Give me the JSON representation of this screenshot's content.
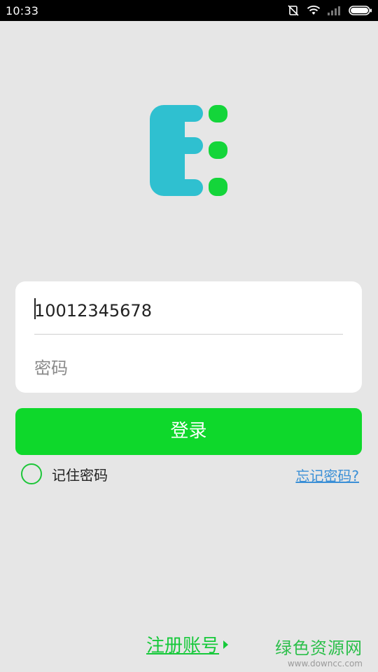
{
  "status_bar": {
    "time": "10:33",
    "icons": [
      "vibrate-off-icon",
      "wifi-icon",
      "signal-icon",
      "battery-icon"
    ]
  },
  "logo": {
    "name": "app-logo",
    "colors": {
      "letter": "#2fc0d0",
      "dots": "#14d53a"
    }
  },
  "login_form": {
    "phone": {
      "value": "10012345678",
      "placeholder": ""
    },
    "password": {
      "value": "",
      "placeholder": "密码"
    }
  },
  "login_button": {
    "label": "登录",
    "color": "#0ed82b"
  },
  "remember": {
    "label": "记住密码",
    "checked": false
  },
  "forgot_link": {
    "label": "忘记密码?"
  },
  "register_link": {
    "label": "注册账号",
    "icon": "arrow-right-icon"
  },
  "watermark": {
    "title": "绿色资源网",
    "url": "www.downcc.com"
  }
}
